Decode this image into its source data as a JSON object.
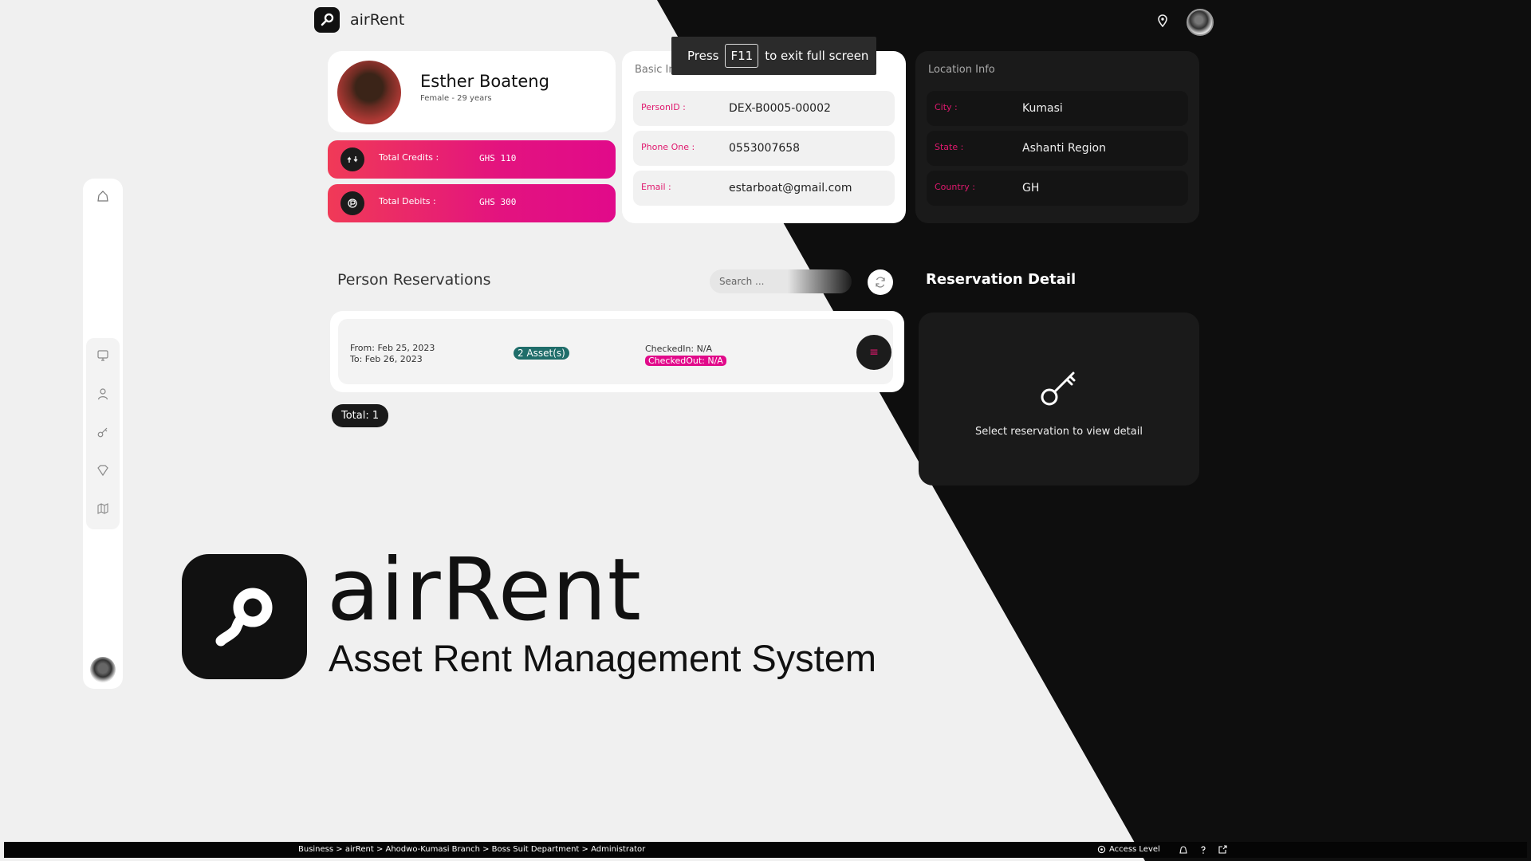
{
  "app": {
    "name": "airRent"
  },
  "profile": {
    "name": "Esther Boateng",
    "subtitle": "Female - 29 years"
  },
  "finance": {
    "credits_label": "Total Credits :",
    "credits_value": "GHS 110",
    "debits_label": "Total Debits :",
    "debits_value": "GHS 300"
  },
  "basic_info": {
    "title": "Basic Info",
    "rows": [
      {
        "key": "PersonID :",
        "value": "DEX-B0005-00002"
      },
      {
        "key": "Phone One :",
        "value": "0553007658"
      },
      {
        "key": "Email :",
        "value": "estarboat@gmail.com"
      }
    ]
  },
  "location_info": {
    "title": "Location Info",
    "rows": [
      {
        "key": "City :",
        "value": "Kumasi"
      },
      {
        "key": "State :",
        "value": "Ashanti Region"
      },
      {
        "key": "Country :",
        "value": "GH"
      }
    ]
  },
  "fullscreen_hint": {
    "press": "Press",
    "key": "F11",
    "rest": "to exit full screen"
  },
  "reservations": {
    "title": "Person Reservations",
    "search_placeholder": "Search ...",
    "items": [
      {
        "from": "From: Feb 25, 2023",
        "to": "To: Feb 26, 2023",
        "assets": "2 Asset(s)",
        "checked_in": "CheckedIn: N/A",
        "checked_out": "CheckedOut: N/A"
      }
    ],
    "total": "Total: 1"
  },
  "detail": {
    "title": "Reservation Detail",
    "empty_message": "Select reservation to view detail"
  },
  "brand": {
    "name": "airRent",
    "tagline": "Asset Rent Management System"
  },
  "status_bar": {
    "breadcrumb": "Business > airRent > Ahodwo-Kumasi Branch > Boss Suit Department > Administrator",
    "access_label": "Access Level"
  },
  "colors": {
    "accent_pink": "#e10a8a",
    "accent_red": "#f03a57",
    "badge_teal": "#1f6d6a",
    "dark": "#0e0e0e"
  },
  "icons": {
    "sidebar": [
      "home-icon",
      "screen-icon",
      "user-icon",
      "key-icon",
      "tag-icon",
      "map-icon"
    ],
    "top": [
      "location-pin-icon"
    ],
    "status": [
      "bell-icon",
      "help-icon",
      "logout-icon"
    ]
  }
}
